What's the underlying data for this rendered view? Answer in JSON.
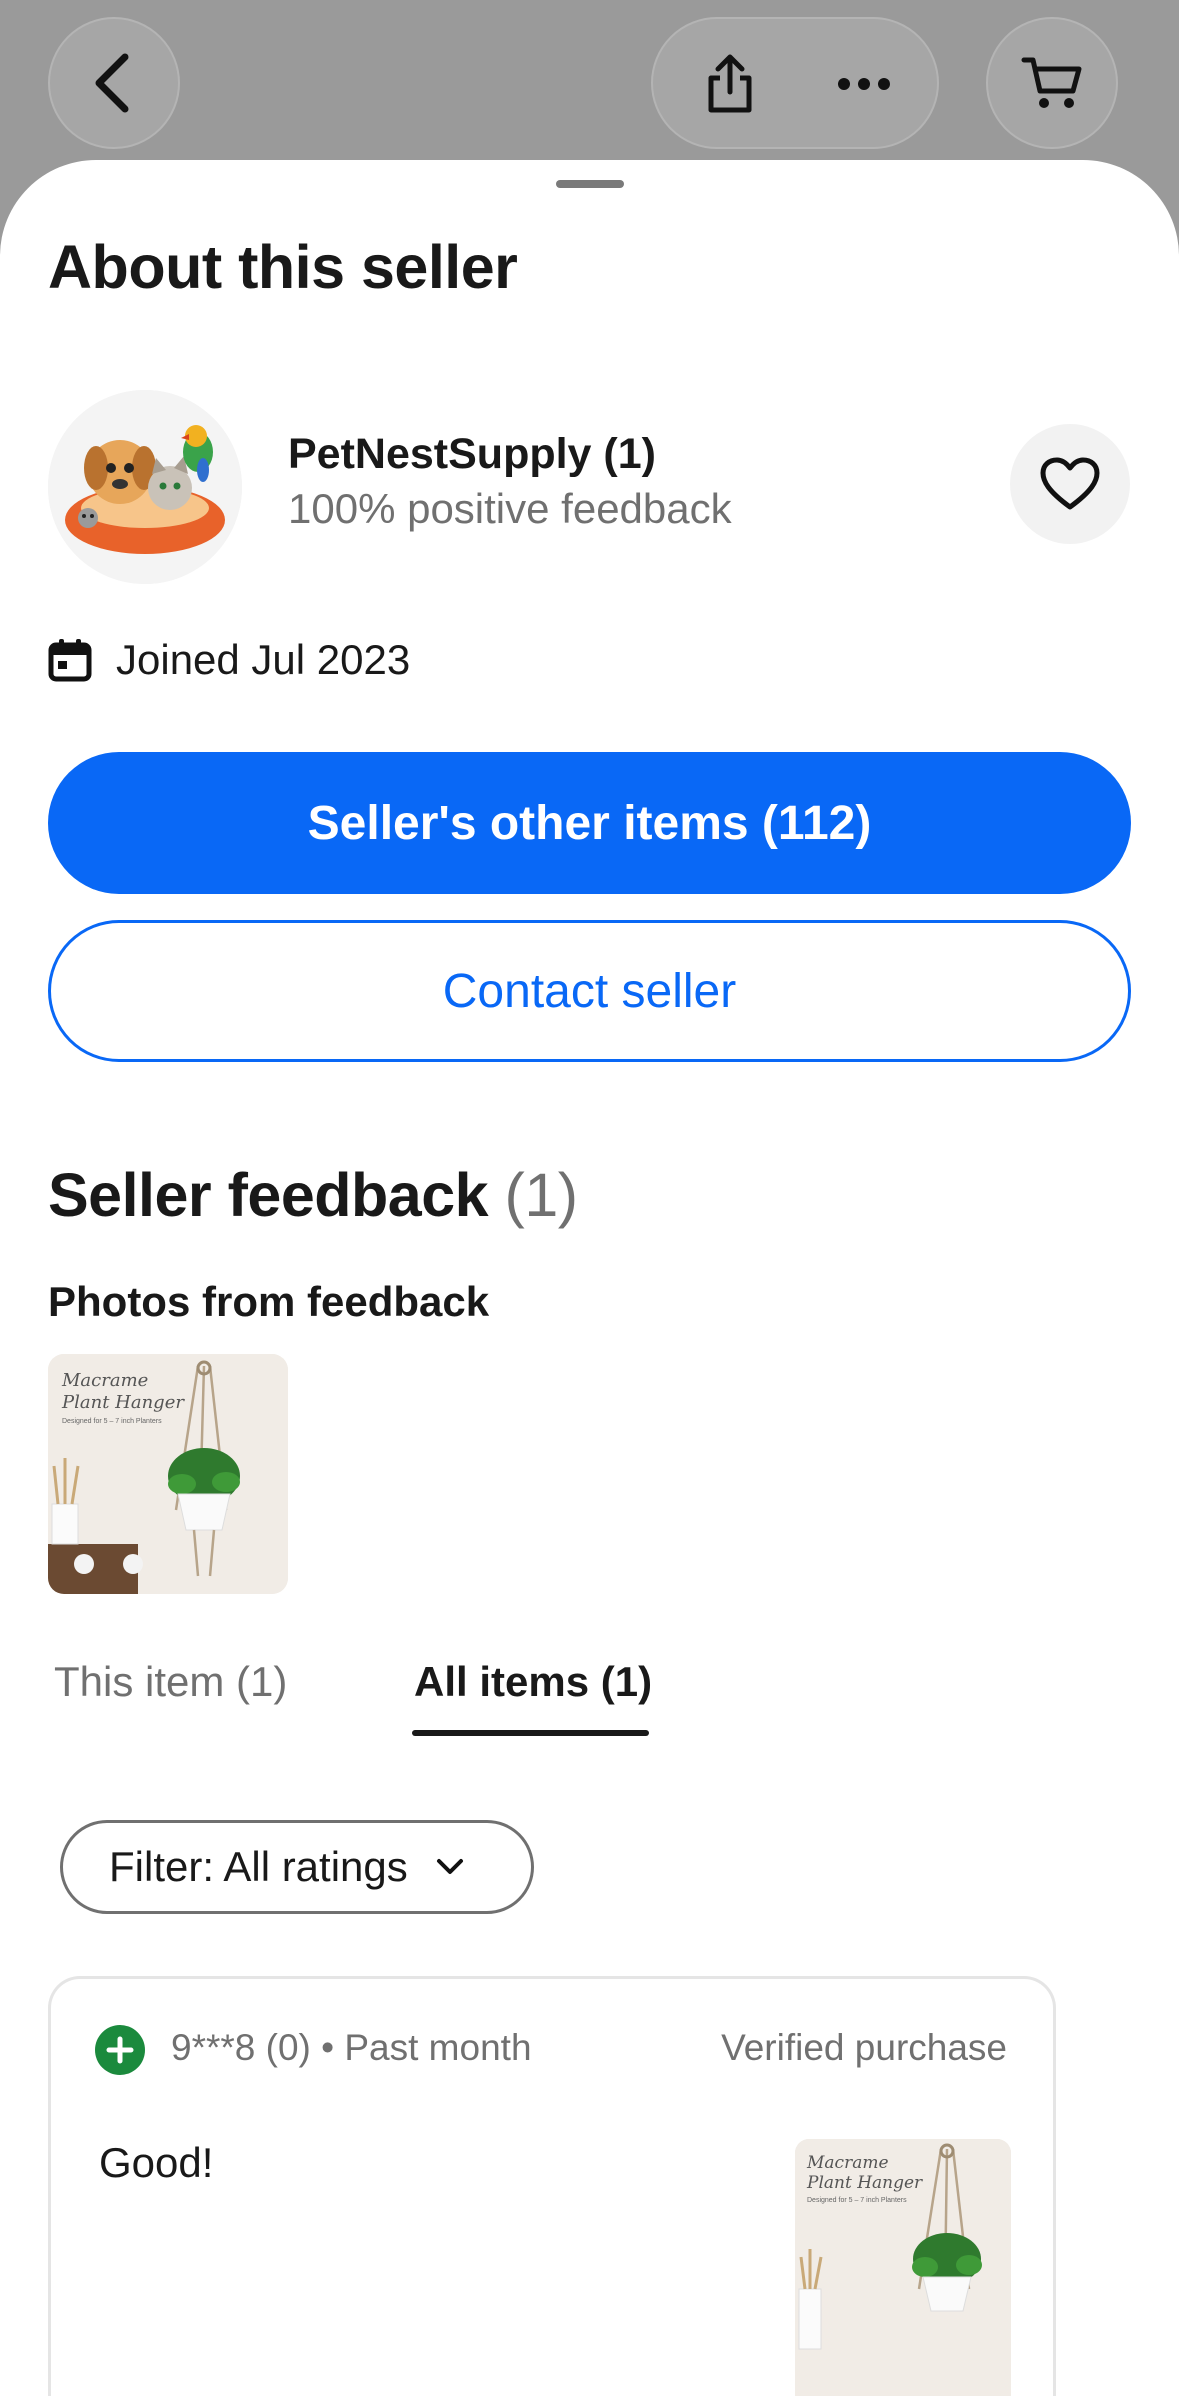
{
  "sheet": {
    "title": "About this seller"
  },
  "seller": {
    "name": "PetNestSupply (1)",
    "feedback_percent": "100% positive feedback",
    "joined": "Joined Jul 2023"
  },
  "buttons": {
    "other_items": "Seller's other items (112)",
    "contact": "Contact seller"
  },
  "feedback": {
    "title": "Seller feedback",
    "count": "(1)",
    "photos_title": "Photos from feedback",
    "tabs": [
      {
        "label": "This item (1)",
        "active": false
      },
      {
        "label": "All items (1)",
        "active": true
      }
    ],
    "filter_label": "Filter: All ratings",
    "entries": [
      {
        "user": "9***8 (0) • Past month",
        "verified": "Verified purchase",
        "comment": "Good!",
        "rating": "positive"
      }
    ]
  },
  "product_image": {
    "title_line1": "Macrame",
    "title_line2": "Plant Hanger",
    "subtitle": "Designed for 5 – 7 inch Planters"
  },
  "colors": {
    "primary": "#0968f6",
    "positive": "#1b8a3d",
    "muted_text": "#707070",
    "overlay": "#9a9a9a"
  },
  "icons": {
    "back": "chevron-left-icon",
    "share": "share-icon",
    "more": "more-horizontal-icon",
    "cart": "cart-icon",
    "favorite": "heart-icon",
    "calendar": "calendar-icon",
    "filter_chevron": "chevron-down-icon",
    "positive_rating": "plus-circle-icon"
  }
}
